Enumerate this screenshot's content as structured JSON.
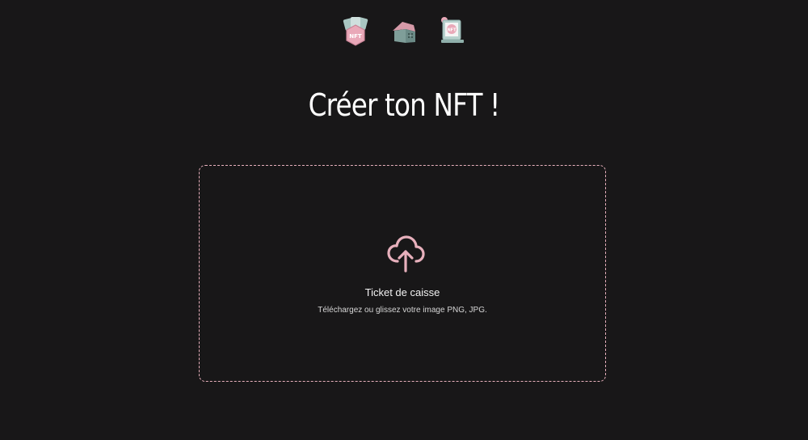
{
  "nav": {
    "items": [
      {
        "icon": "nft-badge-icon",
        "label": "NFT"
      },
      {
        "icon": "house-icon"
      },
      {
        "icon": "nft-frame-icon",
        "label": "NFT"
      }
    ]
  },
  "page": {
    "title": "Créer ton NFT !"
  },
  "dropzone": {
    "icon": "cloud-upload-icon",
    "title": "Ticket de caisse",
    "hint": "Téléchargez ou glissez votre image PNG, JPG."
  },
  "colors": {
    "background": "#181718",
    "accent": "#e7b0bc"
  }
}
